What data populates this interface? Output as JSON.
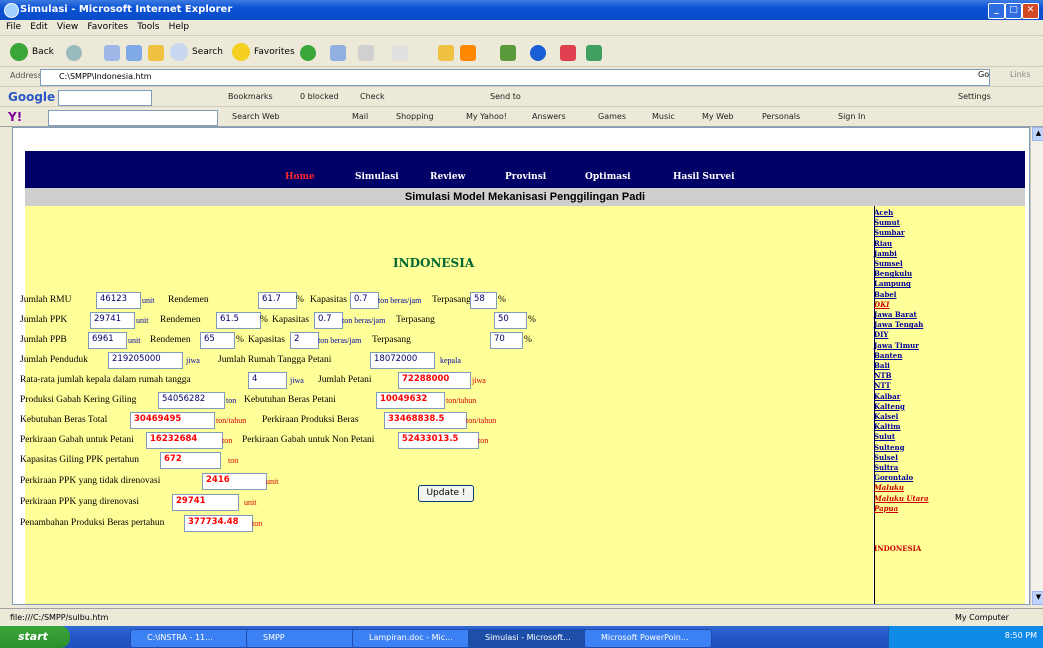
{
  "window": {
    "title": "Simulasi - Microsoft Internet Explorer"
  },
  "menu": [
    "File",
    "Edit",
    "View",
    "Favorites",
    "Tools",
    "Help"
  ],
  "toolbar": {
    "back": "Back",
    "search": "Search",
    "favorites": "Favorites"
  },
  "address": {
    "label": "Address",
    "value": "C:\\SMPP\\Indonesia.htm",
    "go": "Go",
    "links": "Links"
  },
  "google": {
    "brand": "Google",
    "bookmarks": "Bookmarks",
    "blocked": "0 blocked",
    "check": "Check",
    "sendto": "Send to",
    "settings": "Settings"
  },
  "yahoo": {
    "brand": "Y!",
    "searchweb": "Search Web",
    "mail": "Mail",
    "shopping": "Shopping",
    "myyahoo": "My Yahoo!",
    "answers": "Answers",
    "games": "Games",
    "music": "Music",
    "myweb": "My Web",
    "personals": "Personals",
    "signin": "Sign In"
  },
  "nav": {
    "items": [
      "Home",
      "Simulasi",
      "Review",
      "Provinsi",
      "Optimasi",
      "Hasil Survei"
    ]
  },
  "page": {
    "title": "Simulasi Model Mekanisasi Penggilingan Padi",
    "country": "INDONESIA"
  },
  "form": {
    "rmu": {
      "label": "Jumlah RMU",
      "value": "46123",
      "unit": "unit",
      "rend_label": "Rendemen",
      "rend": "61.7",
      "pct": "%",
      "kap_label": "Kapasitas",
      "kap": "0.7",
      "kap_unit": "ton beras/jam",
      "terp_label": "Terpasang",
      "terp": "58",
      "terp_unit": "%"
    },
    "ppk": {
      "label": "Jumlah PPK",
      "value": "29741",
      "unit": "unit",
      "rend_label": "Rendemen",
      "rend": "61.5",
      "pct": "%",
      "kap_label": "Kapasitas",
      "kap": "0.7",
      "kap_unit": "ton beras/jam",
      "terp_label": "Terpasang",
      "terp": "50",
      "terp_unit": "%"
    },
    "ppb": {
      "label": "Jumlah PPB",
      "value": "6961",
      "unit": "unit",
      "rend_label": "Rendemen",
      "rend": "65",
      "pct": "%",
      "kap_label": "Kapasitas",
      "kap": "2",
      "kap_unit": "ton beras/jam",
      "terp_label": "Terpasang",
      "terp": "70",
      "terp_unit": "%"
    },
    "penduduk": {
      "label": "Jumlah Penduduk",
      "value": "219205000",
      "unit": "jiwa",
      "rtp_label": "Jumlah Rumah Tangga Petani",
      "rtp": "18072000",
      "rtp_unit": "kepala"
    },
    "kepala": {
      "label": "Rata-rata jumlah kepala dalam rumah tangga",
      "value": "4",
      "unit": "jiwa",
      "petani_label": "Jumlah Petani",
      "petani": "72288000",
      "petani_unit": "jiwa"
    },
    "gkg": {
      "label": "Produksi Gabah Kering Giling",
      "value": "54056282",
      "unit": "ton",
      "kbp_label": "Kebutuhan Beras Petani",
      "kbp": "10049632",
      "kbp_unit": "ton/tahun"
    },
    "kbt": {
      "label": "Kebutuhan Beras Total",
      "value": "30469495",
      "unit": "ton/tahun",
      "ppb_label": "Perkiraan Produksi Beras",
      "ppb": "33468838.5",
      "ppb_unit": "ton/tahun"
    },
    "gabah": {
      "label": "Perkiraan Gabah untuk Petani",
      "value": "16232684",
      "unit": "ton",
      "nonpet_label": "Perkiraan Gabah untuk Non Petani",
      "nonpet": "52433013.5",
      "nonpet_unit": "ton"
    },
    "kapgiling": {
      "label": "Kapasitas Giling PPK pertahun",
      "value": "672",
      "unit": "ton"
    },
    "tidak": {
      "label": "Perkiraan PPK yang tidak direnovasi",
      "value": "2416",
      "unit": "unit"
    },
    "reno": {
      "label": "Perkiraan PPK yang direnovasi",
      "value": "29741",
      "unit": "unit"
    },
    "tambah": {
      "label": "Penambahan Produksi Beras pertahun",
      "value": "377734.48",
      "unit": "ton"
    },
    "update": "Update !"
  },
  "provinces": [
    "Aceh",
    "Sumut",
    "Sumbar",
    "Riau",
    "Jambi",
    "Sumsel",
    "Bengkulu",
    "Lampung",
    "Babel",
    "DKI",
    "Jawa Barat",
    "Jawa Tengah",
    "DIY",
    "Jawa Timur",
    "Banten",
    "Bali",
    "NTB",
    "NTT",
    "Kalbar",
    "Kalteng",
    "Kalsel",
    "Kaltim",
    "Sulut",
    "Sulteng",
    "Sulsel",
    "Sultra",
    "Gorontalo",
    "Maluku",
    "Maluku Utara",
    "Papua"
  ],
  "selected_province": "INDONESIA",
  "status": {
    "left": "file:///C:/SMPP/sulbu.htm",
    "right": "My Computer"
  },
  "taskbar": {
    "start": "start",
    "tasks": [
      "C:\\INSTRA - 11...",
      "SMPP",
      "Lampiran.doc - Mic...",
      "Simulasi - Microsoft...",
      "Microsoft PowerPoin..."
    ],
    "clock": "8:50 PM"
  },
  "colors": {
    "nav_bg": "#000066",
    "main_bg": "#ffff99",
    "accent_red": "#cc0000",
    "title_bar": "#cfcfcf"
  }
}
